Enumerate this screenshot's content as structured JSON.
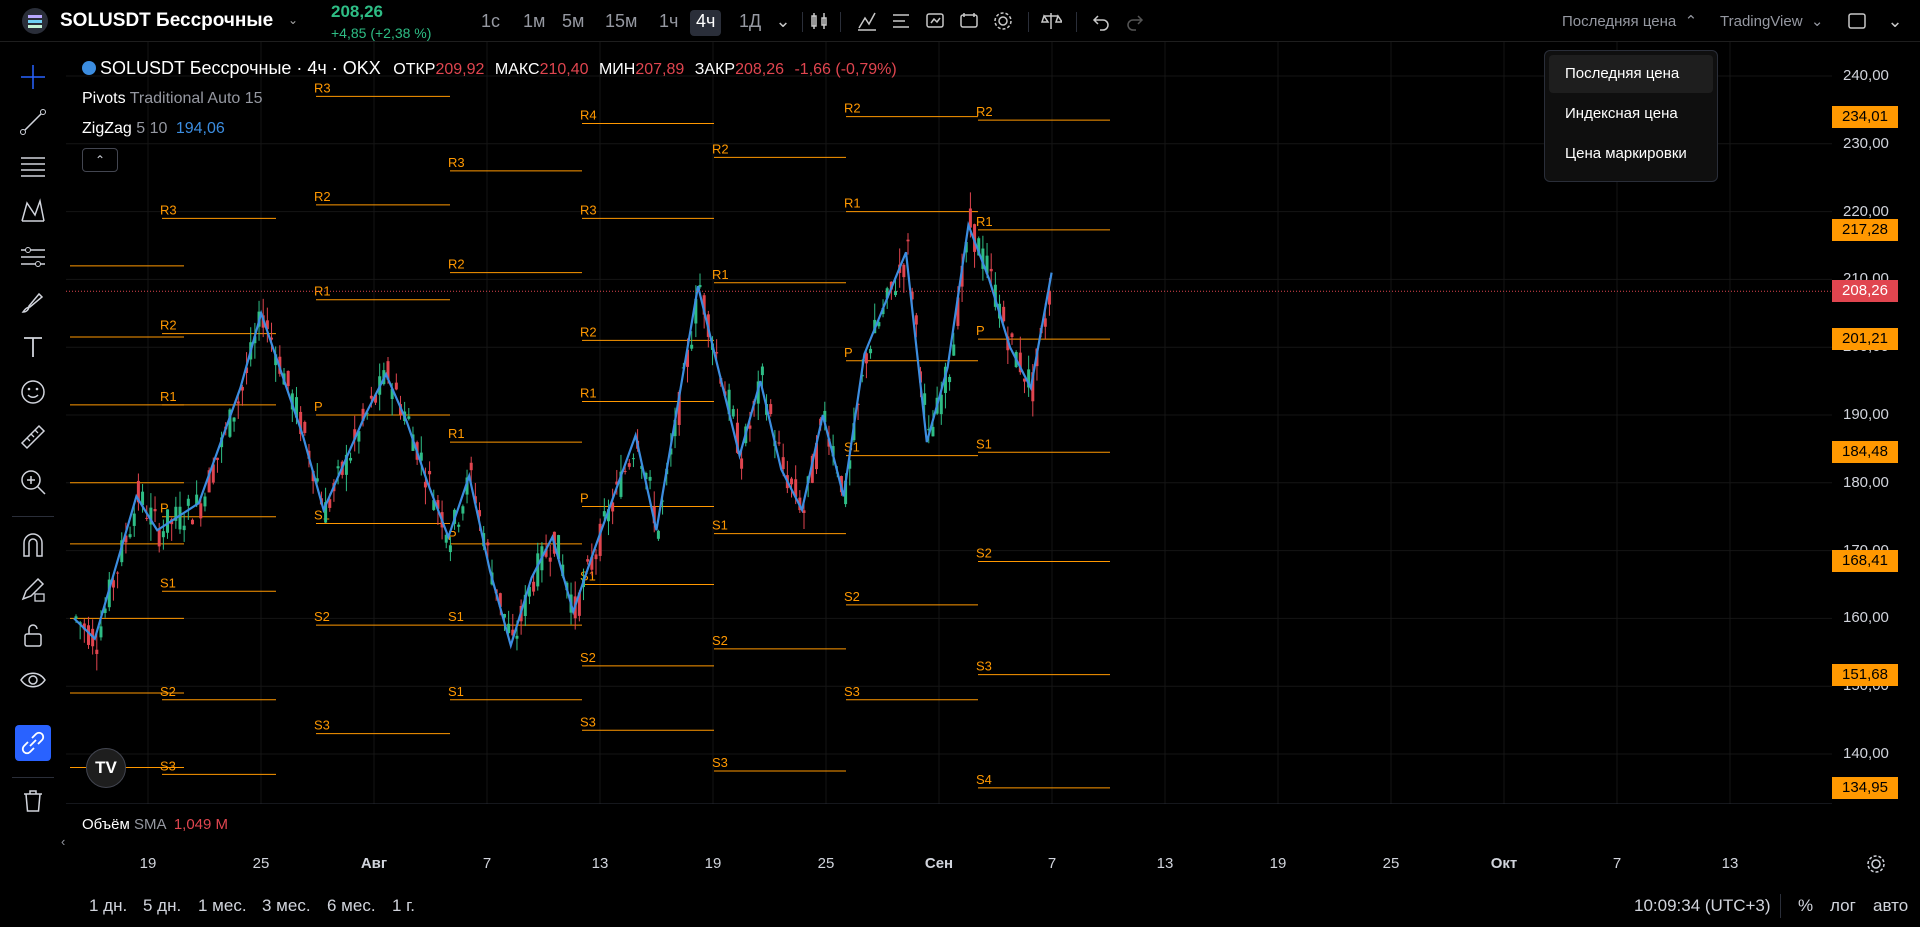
{
  "header": {
    "symbol": "SOLUSDT Бессрочные",
    "last_price": "208,26",
    "change": "+4,85 (+2,38 %)",
    "intervals": [
      "1с",
      "1м",
      "5м",
      "15м",
      "1ч",
      "4ч",
      "1Д"
    ],
    "active_interval": "4ч",
    "price_source": "Последняя цена",
    "data_source": "TradingView"
  },
  "legend": {
    "title": "SOLUSDT Бессрочные · 4ч · OKX",
    "open_label": "ОТКР",
    "open": "209,92",
    "high_label": "МАКС",
    "high": "210,40",
    "low_label": "МИН",
    "low": "207,89",
    "close_label": "ЗАКР",
    "close": "208,26",
    "change": "-1,66 (-0,79%)",
    "pivots_name": "Pivots",
    "pivots_params": "Traditional Auto 15",
    "zigzag_name": "ZigZag",
    "zigzag_params": "5 10",
    "zigzag_value": "194,06"
  },
  "dropdown": {
    "items": [
      "Последняя цена",
      "Индексная цена",
      "Цена маркировки"
    ],
    "selected": "Последняя цена"
  },
  "price_axis": {
    "ticks": [
      "240,00",
      "230,00",
      "220,00",
      "210,00",
      "200,00",
      "190,00",
      "180,00",
      "170,00",
      "160,00",
      "150,00",
      "140,00"
    ],
    "tags": [
      {
        "value": "234,01",
        "color": "#ff9800"
      },
      {
        "value": "217,28",
        "color": "#ff9800"
      },
      {
        "value": "208,26",
        "color": "#e0454f"
      },
      {
        "value": "201,21",
        "color": "#ff9800"
      },
      {
        "value": "184,48",
        "color": "#ff9800"
      },
      {
        "value": "168,41",
        "color": "#ff9800"
      },
      {
        "value": "151,68",
        "color": "#ff9800"
      },
      {
        "value": "134,95",
        "color": "#ff9800"
      }
    ]
  },
  "time_axis": {
    "labels": [
      "19",
      "25",
      "Авг",
      "7",
      "13",
      "19",
      "25",
      "Сен",
      "7",
      "13",
      "19",
      "25",
      "Окт",
      "7",
      "13"
    ]
  },
  "volume": {
    "label": "Объём",
    "ma": "SMA",
    "value": "1,049 M"
  },
  "bottom": {
    "ranges": [
      "1 дн.",
      "5 дн.",
      "1 мес.",
      "3 мес.",
      "6 мес.",
      "1 г."
    ],
    "time": "10:09:34 (UTC+3)",
    "percent": "%",
    "log": "лог",
    "auto": "авто"
  },
  "chart_data": {
    "type": "candlestick",
    "ylim": [
      128,
      243
    ],
    "zigzag": [
      [
        0,
        160
      ],
      [
        1,
        157
      ],
      [
        3,
        178
      ],
      [
        4,
        173
      ],
      [
        6,
        177
      ],
      [
        8,
        194
      ],
      [
        9,
        205
      ],
      [
        11,
        187
      ],
      [
        12,
        176
      ],
      [
        14,
        190
      ],
      [
        15,
        196
      ],
      [
        16,
        189
      ],
      [
        17,
        180
      ],
      [
        18,
        172
      ],
      [
        19,
        181
      ],
      [
        20,
        167
      ],
      [
        21,
        156
      ],
      [
        22,
        166
      ],
      [
        23,
        172
      ],
      [
        24,
        161
      ],
      [
        25,
        170
      ],
      [
        27,
        187
      ],
      [
        28,
        173
      ],
      [
        30,
        209
      ],
      [
        32,
        184
      ],
      [
        33,
        195
      ],
      [
        34,
        182
      ],
      [
        35,
        176
      ],
      [
        36,
        190
      ],
      [
        37,
        178
      ],
      [
        38,
        199
      ],
      [
        40,
        214
      ],
      [
        41,
        186
      ],
      [
        42,
        197
      ],
      [
        43,
        218
      ],
      [
        44,
        210
      ],
      [
        45,
        200
      ],
      [
        46,
        194
      ],
      [
        47,
        211
      ]
    ],
    "pivot_blocks": [
      {
        "levels": [
          {
            "l": "R3",
            "v": 219
          },
          {
            "l": "R2",
            "v": 202
          },
          {
            "l": "R1",
            "v": 191.5
          },
          {
            "l": "P",
            "v": 175
          },
          {
            "l": "S1",
            "v": 164
          },
          {
            "l": "S2",
            "v": 148
          },
          {
            "l": "S3",
            "v": 137
          }
        ]
      },
      {
        "levels": [
          {
            "l": "R3",
            "v": 237
          },
          {
            "l": "R2",
            "v": 221
          },
          {
            "l": "R1",
            "v": 207
          },
          {
            "l": "P",
            "v": 190
          },
          {
            "l": "S1",
            "v": 174
          },
          {
            "l": "S2",
            "v": 159
          },
          {
            "l": "S3",
            "v": 143
          }
        ]
      },
      {
        "levels": [
          {
            "l": "R3",
            "v": 226
          },
          {
            "l": "R2",
            "v": 211
          },
          {
            "l": "R1",
            "v": 186
          },
          {
            "l": "P",
            "v": 171
          },
          {
            "l": "S1",
            "v": 159
          },
          {
            "l": "S1",
            "v": 148
          }
        ]
      },
      {
        "levels": [
          {
            "l": "R4",
            "v": 233
          },
          {
            "l": "R3",
            "v": 219
          },
          {
            "l": "R2",
            "v": 201
          },
          {
            "l": "R1",
            "v": 192
          },
          {
            "l": "P",
            "v": 176.5
          },
          {
            "l": "S1",
            "v": 165
          },
          {
            "l": "S2",
            "v": 153
          },
          {
            "l": "S3",
            "v": 143.5
          }
        ]
      },
      {
        "levels": [
          {
            "l": "R2",
            "v": 228
          },
          {
            "l": "R1",
            "v": 209.5
          },
          {
            "l": "S1",
            "v": 172.5
          },
          {
            "l": "S2",
            "v": 155.5
          },
          {
            "l": "S3",
            "v": 137.5
          }
        ]
      },
      {
        "levels": [
          {
            "l": "R2",
            "v": 234
          },
          {
            "l": "R1",
            "v": 220
          },
          {
            "l": "P",
            "v": 198
          },
          {
            "l": "S1",
            "v": 184
          },
          {
            "l": "S2",
            "v": 162
          },
          {
            "l": "S3",
            "v": 148
          }
        ]
      },
      {
        "levels": [
          {
            "l": "R2",
            "v": 233.5
          },
          {
            "l": "R1",
            "v": 217.3
          },
          {
            "l": "P",
            "v": 201.2
          },
          {
            "l": "S1",
            "v": 184.5
          },
          {
            "l": "S2",
            "v": 168.4
          },
          {
            "l": "S3",
            "v": 151.7
          },
          {
            "l": "S4",
            "v": 135
          }
        ]
      }
    ]
  }
}
